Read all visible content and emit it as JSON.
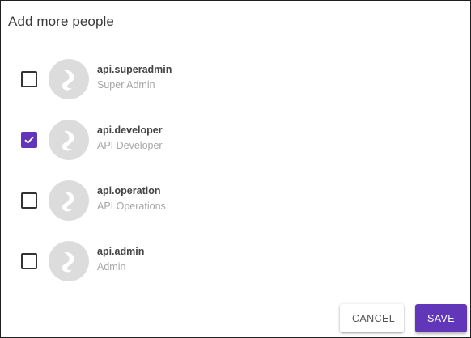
{
  "dialog": {
    "title": "Add more people"
  },
  "people": [
    {
      "name": "api.superadmin",
      "role": "Super Admin",
      "checked": false
    },
    {
      "name": "api.developer",
      "role": "API Developer",
      "checked": true
    },
    {
      "name": "api.operation",
      "role": "API Operations",
      "checked": false
    },
    {
      "name": "api.admin",
      "role": "Admin",
      "checked": false
    }
  ],
  "actions": {
    "cancel_label": "CANCEL",
    "save_label": "SAVE"
  },
  "icons": {
    "check": "check-icon",
    "avatar": "avatar-placeholder-icon"
  },
  "colors": {
    "accent": "#6236b8",
    "avatar_bg": "#dcdcdc",
    "avatar_swirl": "#ffffff"
  }
}
